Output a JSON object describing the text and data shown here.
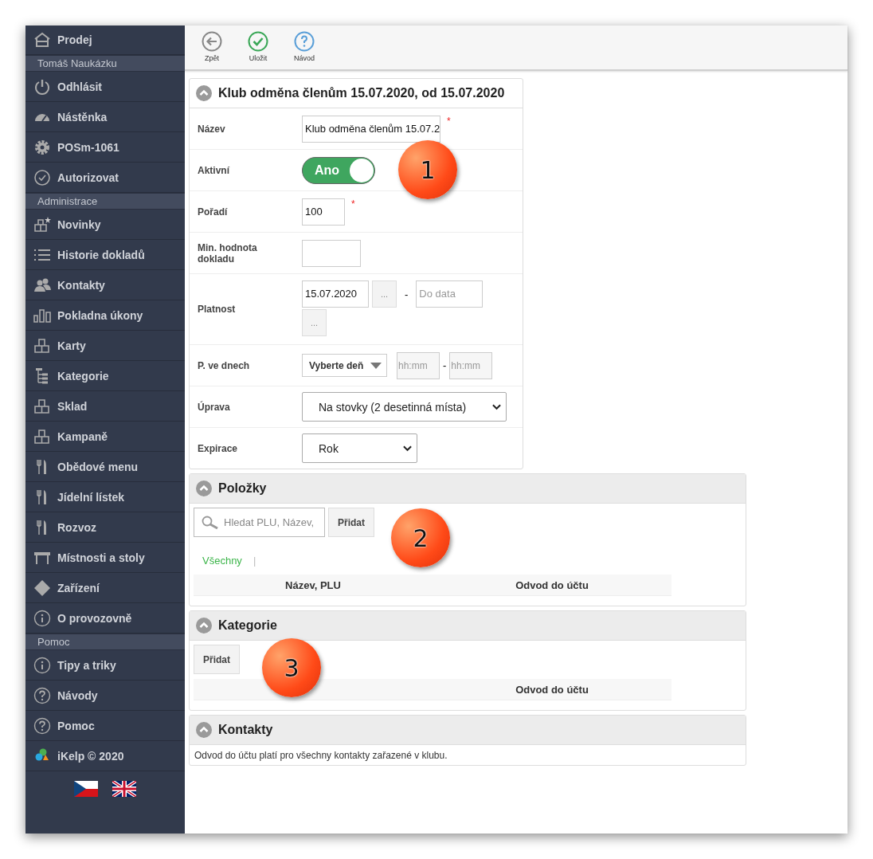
{
  "sidebar": {
    "entries": [
      {
        "kind": "link",
        "label": "Prodej"
      },
      {
        "kind": "heading",
        "label": "Tomáš Naukázku"
      },
      {
        "kind": "link",
        "label": "Odhlásit"
      },
      {
        "kind": "link",
        "label": "Nástěnka"
      },
      {
        "kind": "link",
        "label": "POSm-1061"
      },
      {
        "kind": "link",
        "label": "Autorizovat"
      },
      {
        "kind": "heading",
        "label": "Administrace"
      },
      {
        "kind": "link",
        "label": "Novinky"
      },
      {
        "kind": "link",
        "label": "Historie dokladů"
      },
      {
        "kind": "link",
        "label": "Kontakty"
      },
      {
        "kind": "link",
        "label": "Pokladna úkony"
      },
      {
        "kind": "link",
        "label": "Karty"
      },
      {
        "kind": "link",
        "label": "Kategorie"
      },
      {
        "kind": "link",
        "label": "Sklad"
      },
      {
        "kind": "link",
        "label": "Kampaně"
      },
      {
        "kind": "link",
        "label": "Obědové menu"
      },
      {
        "kind": "link",
        "label": "Jídelní lístek"
      },
      {
        "kind": "link",
        "label": "Rozvoz"
      },
      {
        "kind": "link",
        "label": "Místnosti a stoly"
      },
      {
        "kind": "link",
        "label": "Zařízení"
      },
      {
        "kind": "link",
        "label": "O provozovně"
      },
      {
        "kind": "heading",
        "label": "Pomoc"
      },
      {
        "kind": "link",
        "label": "Tipy a triky"
      },
      {
        "kind": "link",
        "label": "Návody"
      },
      {
        "kind": "link",
        "label": "Pomoc"
      },
      {
        "kind": "link",
        "label": "iKelp © 2020"
      }
    ]
  },
  "toolbar": [
    {
      "label": "Zpět"
    },
    {
      "label": "Uložit"
    },
    {
      "label": "Návod"
    }
  ],
  "form": {
    "title": "Klub odměna členům 15.07.2020, od 15.07.2020",
    "rows": [
      {
        "kind": "text",
        "label": "Název",
        "value": "Klub odměna členům 15.07.2",
        "required_mark": "*"
      },
      {
        "kind": "toggle",
        "label": "Aktivní",
        "text": "Ano",
        "on": true
      },
      {
        "kind": "number",
        "label": "Pořadí",
        "value": "100",
        "required_mark": "*"
      },
      {
        "kind": "number",
        "label": "Min. hodnota dokladu"
      },
      {
        "kind": "date_range",
        "label": "Platnost",
        "from": "15.07.2020",
        "picker": "...",
        "separator": "-",
        "to_placeholder": "Do data"
      },
      {
        "kind": "days",
        "label": "P. ve dnech",
        "select": "Vyberte deň",
        "time_from": "hh:mm",
        "separator": "-",
        "time_to": "hh:mm"
      },
      {
        "kind": "select",
        "label": "Úprava",
        "value": "Na stovky (2 desetinná místa)"
      },
      {
        "kind": "select_short",
        "label": "Expirace",
        "value": "Rok"
      }
    ]
  },
  "sections": [
    {
      "title": "Položky",
      "search_placeholder": "Hledat PLU, Název,",
      "button": "Přidat",
      "filters": [
        {
          "label": "Všechny",
          "selected": true
        }
      ],
      "filter_separator": "|",
      "columns": [
        "Název, PLU",
        "Odvod do účtu"
      ]
    },
    {
      "title": "Kategorie",
      "button": "Přidat",
      "columns": [
        "Odvod do účtu"
      ]
    },
    {
      "title": "Kontakty",
      "note": "Odvod do účtu platí pro všechny kontakty zařazené v klubu."
    }
  ],
  "callouts": [
    {
      "label": "1"
    },
    {
      "label": "2"
    },
    {
      "label": "3"
    }
  ]
}
